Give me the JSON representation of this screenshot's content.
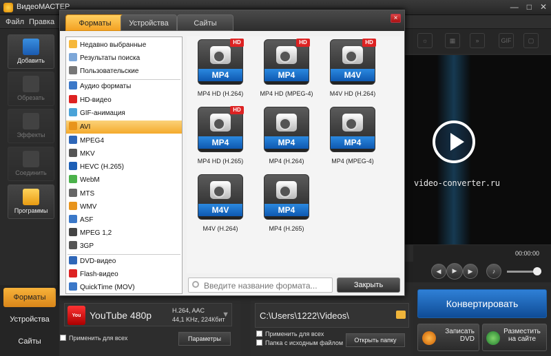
{
  "app": {
    "title": "ВидеоМАСТЕР",
    "menu": [
      "Файл",
      "Правка"
    ]
  },
  "left_toolbar": [
    {
      "label": "Добавить",
      "enabled": true
    },
    {
      "label": "Обрезать",
      "enabled": false
    },
    {
      "label": "Эффекты",
      "enabled": false
    },
    {
      "label": "Соединить",
      "enabled": false
    },
    {
      "label": "Программы",
      "enabled": true
    }
  ],
  "bottom_tabs": [
    "Форматы",
    "Устройства",
    "Сайты"
  ],
  "dialog": {
    "tabs": [
      "Форматы",
      "Устройства",
      "Сайты"
    ],
    "active_tab": "Форматы",
    "close_icon": "×",
    "categories_top": [
      "Недавно выбранные",
      "Результаты поиска",
      "Пользовательские"
    ],
    "categories_formats": [
      "Аудио форматы",
      "HD-видео",
      "GIF-анимация",
      "AVI",
      "MPEG4",
      "MKV",
      "HEVC (H.265)",
      "WebM",
      "MTS",
      "WMV",
      "ASF",
      "MPEG 1,2",
      "3GP"
    ],
    "categories_other": [
      "DVD-видео",
      "Flash-видео",
      "QuickTime (MOV)"
    ],
    "selected_category": "AVI",
    "formats": [
      {
        "badge": "MP4",
        "hd": true,
        "caption": "MP4 HD (H.264)"
      },
      {
        "badge": "MP4",
        "hd": true,
        "caption": "MP4 HD (MPEG-4)"
      },
      {
        "badge": "M4V",
        "hd": true,
        "caption": "M4V HD (H.264)"
      },
      {
        "badge": "MP4",
        "hd": true,
        "caption": "MP4 HD (H.265)"
      },
      {
        "badge": "MP4",
        "hd": false,
        "caption": "MP4 (H.264)"
      },
      {
        "badge": "MP4",
        "hd": false,
        "caption": "MP4 (MPEG-4)"
      },
      {
        "badge": "M4V",
        "hd": false,
        "caption": "M4V (H.264)"
      },
      {
        "badge": "MP4",
        "hd": false,
        "caption": "MP4 (H.265)"
      }
    ],
    "hd_label": "HD",
    "search_placeholder": "Введите название формата...",
    "close_button": "Закрыть"
  },
  "output": {
    "format_name": "YouTube 480p",
    "codec_line1": "H.264, AAC",
    "codec_line2": "44,1 KHz, 224Кбит",
    "apply_all": "Применить для всех",
    "params_button": "Параметры"
  },
  "folder": {
    "path": "C:\\Users\\1222\\Videos\\",
    "apply_all": "Применить для всех",
    "source_folder": "Папка с исходным файлом",
    "open_folder": "Открыть папку"
  },
  "convert": {
    "button": "Конвертировать",
    "dvd": "Записать DVD",
    "site": "Разместить на сайте"
  },
  "preview": {
    "watermark": "video-converter.ru",
    "time": "00:00:00",
    "time_right": "00:00:00"
  },
  "colors": {
    "accent": "#f3a223",
    "blue": "#1a6fd0",
    "hd_red": "#d22222"
  }
}
